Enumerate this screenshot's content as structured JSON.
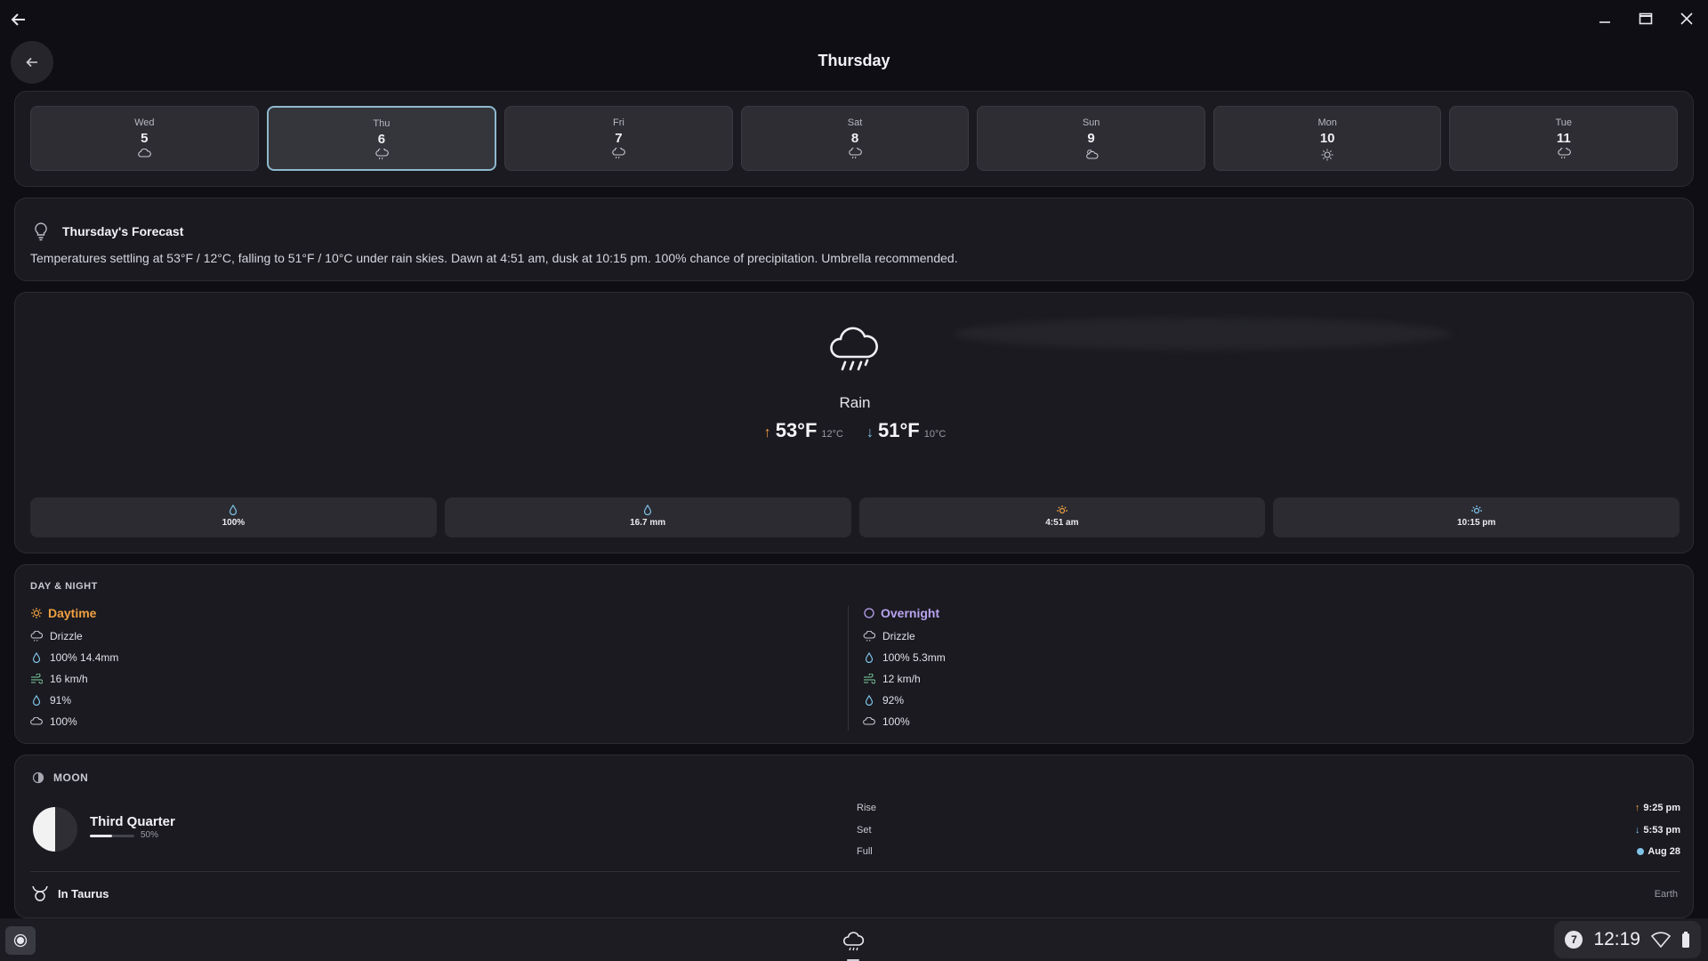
{
  "page": {
    "title": "Thursday"
  },
  "days": [
    {
      "name": "Wed",
      "date": "5",
      "icon": "cloud-icon"
    },
    {
      "name": "Thu",
      "date": "6",
      "icon": "rain-icon",
      "selected": true
    },
    {
      "name": "Fri",
      "date": "7",
      "icon": "rain-icon"
    },
    {
      "name": "Sat",
      "date": "8",
      "icon": "rain-icon"
    },
    {
      "name": "Sun",
      "date": "9",
      "icon": "partly-cloudy-icon"
    },
    {
      "name": "Mon",
      "date": "10",
      "icon": "sun-icon"
    },
    {
      "name": "Tue",
      "date": "11",
      "icon": "rain-icon"
    }
  ],
  "forecast": {
    "title": "Thursday's Forecast",
    "text": "Temperatures settling at 53°F / 12°C, falling to 51°F / 10°C under rain skies. Dawn at 4:51 am, dusk at 10:15 pm. 100% chance of precipitation. Umbrella recommended."
  },
  "current": {
    "condition": "Rain",
    "high_f": "53°F",
    "high_c": "12°C",
    "low_f": "51°F",
    "low_c": "10°C",
    "stats": [
      {
        "icon": "droplet-icon",
        "value": "100%"
      },
      {
        "icon": "droplet-icon",
        "value": "16.7 mm"
      },
      {
        "icon": "sunrise-icon",
        "value": "4:51 am"
      },
      {
        "icon": "sunset-icon",
        "value": "10:15 pm"
      }
    ]
  },
  "day_night": {
    "label": "DAY & NIGHT",
    "day": {
      "title": "Daytime",
      "condition": "Drizzle",
      "precip": "100%  14.4mm",
      "wind": "16 km/h",
      "humidity": "91%",
      "cloud": "100%"
    },
    "night": {
      "title": "Overnight",
      "condition": "Drizzle",
      "precip": "100%  5.3mm",
      "wind": "12 km/h",
      "humidity": "92%",
      "cloud": "100%"
    }
  },
  "moon": {
    "label": "MOON",
    "phase": "Third Quarter",
    "illumination": "50%",
    "illumination_value": 0.5,
    "rise_label": "Rise",
    "rise": "9:25 pm",
    "set_label": "Set",
    "set": "5:53 pm",
    "full_label": "Full",
    "full": "Aug 28",
    "zodiac": "In Taurus",
    "element": "Earth"
  },
  "taskbar": {
    "notification_count": "7",
    "time": "12:19"
  },
  "colors": {
    "accent_day": "#f0a040",
    "accent_night": "#b9a3f0",
    "selected_border": "#8fb9cf",
    "droplet": "#7fc3e8"
  }
}
